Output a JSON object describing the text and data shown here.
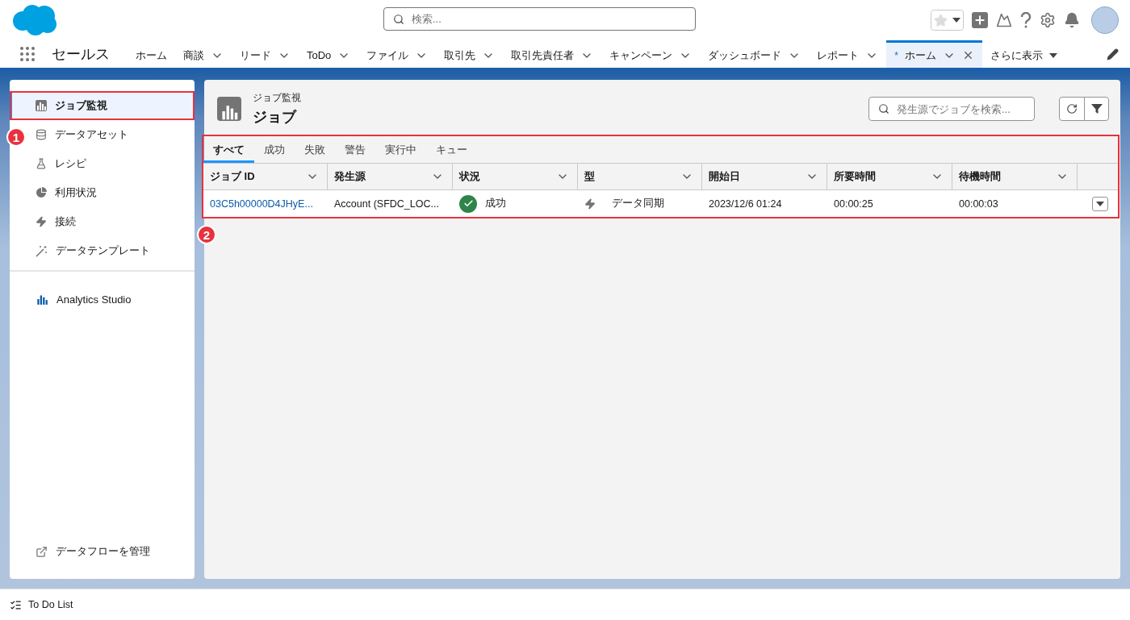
{
  "header": {
    "search": {
      "placeholder": "検索..."
    }
  },
  "app_name": "セールス",
  "nav_tabs": [
    {
      "label": "ホーム",
      "kind": "plain",
      "selected": false
    },
    {
      "label": "商談",
      "kind": "menu",
      "selected": false
    },
    {
      "label": "リード",
      "kind": "menu",
      "selected": false
    },
    {
      "label": "ToDo",
      "kind": "menu",
      "selected": false
    },
    {
      "label": "ファイル",
      "kind": "menu",
      "selected": false
    },
    {
      "label": "取引先",
      "kind": "menu",
      "selected": false
    },
    {
      "label": "取引先責任者",
      "kind": "menu",
      "selected": false
    },
    {
      "label": "キャンペーン",
      "kind": "menu",
      "selected": false
    },
    {
      "label": "ダッシュボード",
      "kind": "menu",
      "selected": false
    },
    {
      "label": "レポート",
      "kind": "menu",
      "selected": false
    },
    {
      "label": "ホーム",
      "marker": "*",
      "kind": "closable",
      "selected": true
    },
    {
      "label": "さらに表示",
      "kind": "more",
      "selected": false
    }
  ],
  "sidebar": {
    "items": [
      {
        "label": "ジョブ監視",
        "selected": true,
        "highlighted": true,
        "callout": "1"
      },
      {
        "label": "データアセット",
        "selected": false,
        "highlighted": false
      },
      {
        "label": "レシピ",
        "selected": false,
        "highlighted": false
      },
      {
        "label": "利用状況",
        "selected": false,
        "highlighted": false
      },
      {
        "label": "接続",
        "selected": false,
        "highlighted": false
      },
      {
        "label": "データテンプレート",
        "selected": false,
        "highlighted": false
      }
    ],
    "studio": {
      "label": "Analytics Studio"
    },
    "footer_link": {
      "label": "データフローを管理"
    }
  },
  "page": {
    "breadcrumb": "ジョブ監視",
    "title": "ジョブ",
    "search": {
      "placeholder": "発生源でジョブを検索..."
    },
    "highlighted": true,
    "callout": "2",
    "tabs": [
      {
        "label": "すべて",
        "selected": true
      },
      {
        "label": "成功",
        "selected": false
      },
      {
        "label": "失敗",
        "selected": false
      },
      {
        "label": "警告",
        "selected": false
      },
      {
        "label": "実行中",
        "selected": false
      },
      {
        "label": "キュー",
        "selected": false
      }
    ],
    "table": {
      "columns": [
        "ジョブ ID",
        "発生源",
        "状況",
        "型",
        "開始日",
        "所要時間",
        "待機時間"
      ],
      "rows": [
        {
          "job_id": "03C5h00000D4JHyE...",
          "source": "Account (SFDC_LOC...",
          "status": {
            "kind": "success",
            "label": "成功"
          },
          "type": "データ同期",
          "start": "2023/12/6 01:24",
          "duration": "00:00:25",
          "wait": "00:00:03"
        }
      ]
    }
  },
  "utility_bar": {
    "label": "To Do List"
  }
}
